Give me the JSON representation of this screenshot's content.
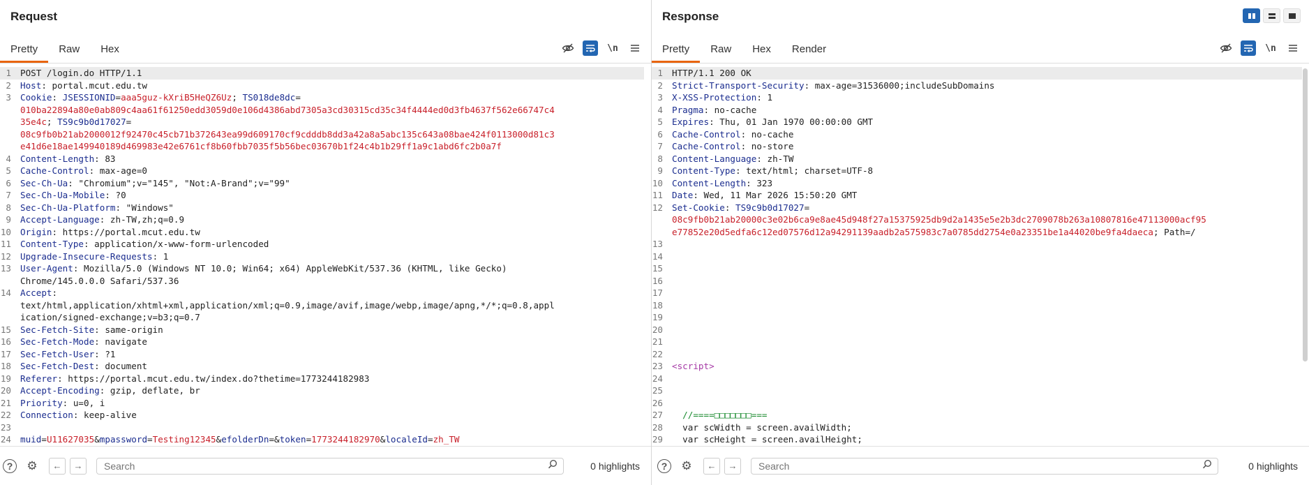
{
  "request": {
    "title": "Request",
    "tabs": [
      "Pretty",
      "Raw",
      "Hex"
    ],
    "newline_label": "\\n",
    "search_placeholder": "Search",
    "highlights": "0 highlights",
    "lines": [
      {
        "n": "1",
        "segs": [
          {
            "c": "",
            "t": "POST /login.do HTTP/1.1"
          }
        ]
      },
      {
        "n": "2",
        "segs": [
          {
            "c": "hn",
            "t": "Host"
          },
          {
            "c": "",
            "t": ": portal.mcut.edu.tw"
          }
        ]
      },
      {
        "n": "3",
        "segs": [
          {
            "c": "hn",
            "t": "Cookie"
          },
          {
            "c": "",
            "t": ": "
          },
          {
            "c": "ck",
            "t": "JSESSIONID"
          },
          {
            "c": "",
            "t": "="
          },
          {
            "c": "cv",
            "t": "aaa5guz-kXriB5HeQZ6Uz"
          },
          {
            "c": "",
            "t": "; "
          },
          {
            "c": "ck",
            "t": "TS018de8dc"
          },
          {
            "c": "",
            "t": "="
          }
        ]
      },
      {
        "n": "",
        "segs": [
          {
            "c": "cv",
            "t": "010ba22894a80e0ab809c4aa61f61250edd3059d0e106d4386abd7305a3cd30315cd35c34f4444ed0d3fb4637f562e66747c4"
          }
        ]
      },
      {
        "n": "",
        "segs": [
          {
            "c": "cv",
            "t": "35e4c"
          },
          {
            "c": "",
            "t": "; "
          },
          {
            "c": "ck",
            "t": "TS9c9b0d17027"
          },
          {
            "c": "",
            "t": "="
          }
        ]
      },
      {
        "n": "",
        "segs": [
          {
            "c": "cv",
            "t": "08c9fb0b21ab2000012f92470c45cb71b372643ea99d609170cf9cdddb8dd3a42a8a5abc135c643a08bae424f0113000d81c3"
          }
        ]
      },
      {
        "n": "",
        "segs": [
          {
            "c": "cv",
            "t": "e41d6e18ae149940189d469983e42e6761cf8b60fbb7035f5b56bec03670b1f24c4b1b29ff1a9c1abd6fc2b0a7f"
          }
        ]
      },
      {
        "n": "4",
        "segs": [
          {
            "c": "hn",
            "t": "Content-Length"
          },
          {
            "c": "",
            "t": ": 83"
          }
        ]
      },
      {
        "n": "5",
        "segs": [
          {
            "c": "hn",
            "t": "Cache-Control"
          },
          {
            "c": "",
            "t": ": max-age=0"
          }
        ]
      },
      {
        "n": "6",
        "segs": [
          {
            "c": "hn",
            "t": "Sec-Ch-Ua"
          },
          {
            "c": "",
            "t": ": \"Chromium\";v=\"145\", \"Not:A-Brand\";v=\"99\""
          }
        ]
      },
      {
        "n": "7",
        "segs": [
          {
            "c": "hn",
            "t": "Sec-Ch-Ua-Mobile"
          },
          {
            "c": "",
            "t": ": ?0"
          }
        ]
      },
      {
        "n": "8",
        "segs": [
          {
            "c": "hn",
            "t": "Sec-Ch-Ua-Platform"
          },
          {
            "c": "",
            "t": ": \"Windows\""
          }
        ]
      },
      {
        "n": "9",
        "segs": [
          {
            "c": "hn",
            "t": "Accept-Language"
          },
          {
            "c": "",
            "t": ": zh-TW,zh;q=0.9"
          }
        ]
      },
      {
        "n": "10",
        "segs": [
          {
            "c": "hn",
            "t": "Origin"
          },
          {
            "c": "",
            "t": ": https://portal.mcut.edu.tw"
          }
        ]
      },
      {
        "n": "11",
        "segs": [
          {
            "c": "hn",
            "t": "Content-Type"
          },
          {
            "c": "",
            "t": ": application/x-www-form-urlencoded"
          }
        ]
      },
      {
        "n": "12",
        "segs": [
          {
            "c": "hn",
            "t": "Upgrade-Insecure-Requests"
          },
          {
            "c": "",
            "t": ": 1"
          }
        ]
      },
      {
        "n": "13",
        "segs": [
          {
            "c": "hn",
            "t": "User-Agent"
          },
          {
            "c": "",
            "t": ": Mozilla/5.0 (Windows NT 10.0; Win64; x64) AppleWebKit/537.36 (KHTML, like Gecko)"
          }
        ]
      },
      {
        "n": "",
        "segs": [
          {
            "c": "",
            "t": "Chrome/145.0.0.0 Safari/537.36"
          }
        ]
      },
      {
        "n": "14",
        "segs": [
          {
            "c": "hn",
            "t": "Accept"
          },
          {
            "c": "",
            "t": ":"
          }
        ]
      },
      {
        "n": "",
        "segs": [
          {
            "c": "",
            "t": "text/html,application/xhtml+xml,application/xml;q=0.9,image/avif,image/webp,image/apng,*/*;q=0.8,appl"
          }
        ]
      },
      {
        "n": "",
        "segs": [
          {
            "c": "",
            "t": "ication/signed-exchange;v=b3;q=0.7"
          }
        ]
      },
      {
        "n": "15",
        "segs": [
          {
            "c": "hn",
            "t": "Sec-Fetch-Site"
          },
          {
            "c": "",
            "t": ": same-origin"
          }
        ]
      },
      {
        "n": "16",
        "segs": [
          {
            "c": "hn",
            "t": "Sec-Fetch-Mode"
          },
          {
            "c": "",
            "t": ": navigate"
          }
        ]
      },
      {
        "n": "17",
        "segs": [
          {
            "c": "hn",
            "t": "Sec-Fetch-User"
          },
          {
            "c": "",
            "t": ": ?1"
          }
        ]
      },
      {
        "n": "18",
        "segs": [
          {
            "c": "hn",
            "t": "Sec-Fetch-Dest"
          },
          {
            "c": "",
            "t": ": document"
          }
        ]
      },
      {
        "n": "19",
        "segs": [
          {
            "c": "hn",
            "t": "Referer"
          },
          {
            "c": "",
            "t": ": https://portal.mcut.edu.tw/index.do?thetime=1773244182983"
          }
        ]
      },
      {
        "n": "20",
        "segs": [
          {
            "c": "hn",
            "t": "Accept-Encoding"
          },
          {
            "c": "",
            "t": ": gzip, deflate, br"
          }
        ]
      },
      {
        "n": "21",
        "segs": [
          {
            "c": "hn",
            "t": "Priority"
          },
          {
            "c": "",
            "t": ": u=0, i"
          }
        ]
      },
      {
        "n": "22",
        "segs": [
          {
            "c": "hn",
            "t": "Connection"
          },
          {
            "c": "",
            "t": ": keep-alive"
          }
        ]
      },
      {
        "n": "23",
        "segs": [
          {
            "c": "",
            "t": ""
          }
        ]
      },
      {
        "n": "24",
        "segs": [
          {
            "c": "ck",
            "t": "muid"
          },
          {
            "c": "",
            "t": "="
          },
          {
            "c": "cv",
            "t": "U11627035"
          },
          {
            "c": "",
            "t": "&"
          },
          {
            "c": "ck",
            "t": "mpassword"
          },
          {
            "c": "",
            "t": "="
          },
          {
            "c": "cv",
            "t": "Testing12345"
          },
          {
            "c": "",
            "t": "&"
          },
          {
            "c": "ck",
            "t": "efolderDn"
          },
          {
            "c": "",
            "t": "=&"
          },
          {
            "c": "ck",
            "t": "token"
          },
          {
            "c": "",
            "t": "="
          },
          {
            "c": "cv",
            "t": "1773244182970"
          },
          {
            "c": "",
            "t": "&"
          },
          {
            "c": "ck",
            "t": "localeId"
          },
          {
            "c": "",
            "t": "="
          },
          {
            "c": "cv",
            "t": "zh_TW"
          }
        ]
      }
    ]
  },
  "response": {
    "title": "Response",
    "tabs": [
      "Pretty",
      "Raw",
      "Hex",
      "Render"
    ],
    "newline_label": "\\n",
    "search_placeholder": "Search",
    "highlights": "0 highlights",
    "lines": [
      {
        "n": "1",
        "segs": [
          {
            "c": "",
            "t": "HTTP/1.1 200 OK"
          }
        ]
      },
      {
        "n": "2",
        "segs": [
          {
            "c": "hn",
            "t": "Strict-Transport-Security"
          },
          {
            "c": "",
            "t": ": max-age=31536000;includeSubDomains"
          }
        ]
      },
      {
        "n": "3",
        "segs": [
          {
            "c": "hn",
            "t": "X-XSS-Protection"
          },
          {
            "c": "",
            "t": ": 1"
          }
        ]
      },
      {
        "n": "4",
        "segs": [
          {
            "c": "hn",
            "t": "Pragma"
          },
          {
            "c": "",
            "t": ": no-cache"
          }
        ]
      },
      {
        "n": "5",
        "segs": [
          {
            "c": "hn",
            "t": "Expires"
          },
          {
            "c": "",
            "t": ": Thu, 01 Jan 1970 00:00:00 GMT"
          }
        ]
      },
      {
        "n": "6",
        "segs": [
          {
            "c": "hn",
            "t": "Cache-Control"
          },
          {
            "c": "",
            "t": ": no-cache"
          }
        ]
      },
      {
        "n": "7",
        "segs": [
          {
            "c": "hn",
            "t": "Cache-Control"
          },
          {
            "c": "",
            "t": ": no-store"
          }
        ]
      },
      {
        "n": "8",
        "segs": [
          {
            "c": "hn",
            "t": "Content-Language"
          },
          {
            "c": "",
            "t": ": zh-TW"
          }
        ]
      },
      {
        "n": "9",
        "segs": [
          {
            "c": "hn",
            "t": "Content-Type"
          },
          {
            "c": "",
            "t": ": text/html; charset=UTF-8"
          }
        ]
      },
      {
        "n": "10",
        "segs": [
          {
            "c": "hn",
            "t": "Content-Length"
          },
          {
            "c": "",
            "t": ": 323"
          }
        ]
      },
      {
        "n": "11",
        "segs": [
          {
            "c": "hn",
            "t": "Date"
          },
          {
            "c": "",
            "t": ": Wed, 11 Mar 2026 15:50:20 GMT"
          }
        ]
      },
      {
        "n": "12",
        "segs": [
          {
            "c": "hn",
            "t": "Set-Cookie"
          },
          {
            "c": "",
            "t": ": "
          },
          {
            "c": "ck",
            "t": "TS9c9b0d17027"
          },
          {
            "c": "",
            "t": "="
          }
        ]
      },
      {
        "n": "",
        "segs": [
          {
            "c": "cv",
            "t": "08c9fb0b21ab20000c3e02b6ca9e8ae45d948f27a15375925db9d2a1435e5e2b3dc2709078b263a10807816e47113000acf95"
          }
        ]
      },
      {
        "n": "",
        "segs": [
          {
            "c": "cv",
            "t": "e77852e20d5edfa6c12ed07576d12a94291139aadb2a575983c7a0785dd2754e0a23351be1a44020be9fa4daeca"
          },
          {
            "c": "",
            "t": "; Path=/"
          }
        ]
      },
      {
        "n": "13",
        "segs": [
          {
            "c": "",
            "t": ""
          }
        ]
      },
      {
        "n": "14",
        "segs": [
          {
            "c": "",
            "t": ""
          }
        ]
      },
      {
        "n": "15",
        "segs": [
          {
            "c": "",
            "t": ""
          }
        ]
      },
      {
        "n": "16",
        "segs": [
          {
            "c": "",
            "t": ""
          }
        ]
      },
      {
        "n": "17",
        "segs": [
          {
            "c": "",
            "t": ""
          }
        ]
      },
      {
        "n": "18",
        "segs": [
          {
            "c": "",
            "t": ""
          }
        ]
      },
      {
        "n": "19",
        "segs": [
          {
            "c": "",
            "t": ""
          }
        ]
      },
      {
        "n": "20",
        "segs": [
          {
            "c": "",
            "t": ""
          }
        ]
      },
      {
        "n": "21",
        "segs": [
          {
            "c": "",
            "t": ""
          }
        ]
      },
      {
        "n": "22",
        "segs": [
          {
            "c": "",
            "t": ""
          }
        ]
      },
      {
        "n": "23",
        "segs": [
          {
            "c": "tag",
            "t": "<script>"
          }
        ]
      },
      {
        "n": "24",
        "segs": [
          {
            "c": "",
            "t": ""
          }
        ]
      },
      {
        "n": "25",
        "segs": [
          {
            "c": "",
            "t": ""
          }
        ]
      },
      {
        "n": "26",
        "segs": [
          {
            "c": "",
            "t": ""
          }
        ]
      },
      {
        "n": "27",
        "segs": [
          {
            "c": "cm",
            "t": "  //====□□□□□□□==="
          }
        ]
      },
      {
        "n": "28",
        "segs": [
          {
            "c": "",
            "t": "  var scWidth = screen.availWidth;"
          }
        ]
      },
      {
        "n": "29",
        "segs": [
          {
            "c": "",
            "t": "  var scHeight = screen.availHeight;"
          }
        ]
      }
    ]
  }
}
